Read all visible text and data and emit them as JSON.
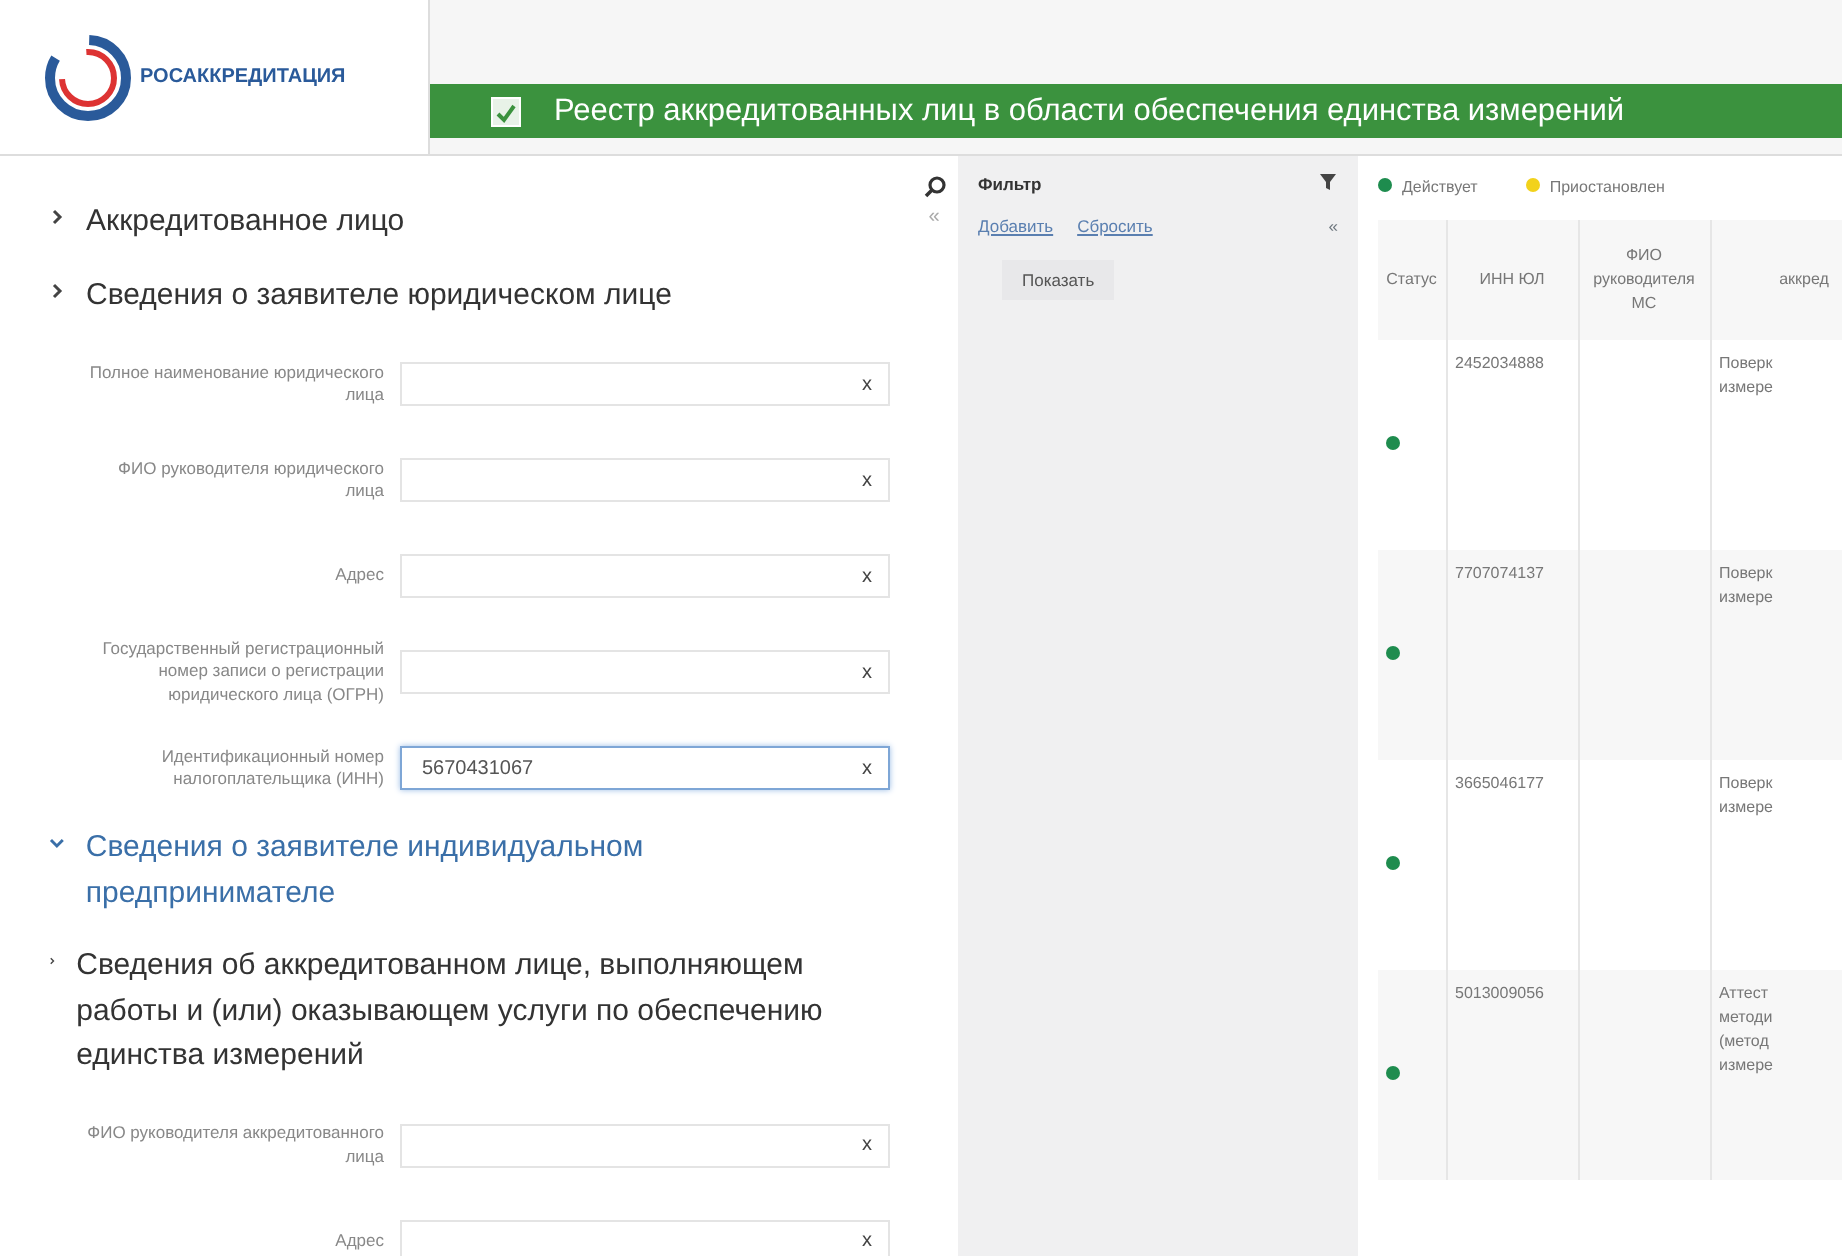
{
  "header": {
    "logo_text": "РОСАККРЕДИТАЦИЯ",
    "title": "Реестр аккредитованных лиц в области обеспечения единства измерений"
  },
  "left_panel": {
    "collapse": "«",
    "sections": [
      {
        "title": "Аккредитованное лицо",
        "expanded": false
      },
      {
        "title": "Сведения о заявителе юридическом лице",
        "expanded": false,
        "fields": [
          {
            "label": "Полное наименование юридического лица",
            "focused": false,
            "clear": "x"
          },
          {
            "label": "ФИО руководителя юридического лица",
            "focused": false,
            "clear": "x"
          },
          {
            "label": "Адрес",
            "focused": false,
            "clear": "x"
          },
          {
            "label": "Государственный регистрационный номер записи о регистрации юридического лица (ОГРН)",
            "focused": false,
            "clear": "x"
          },
          {
            "label": "Идентификационный номер налогоплательщика (ИНН)",
            "value": "5670431067",
            "focused": true,
            "clear": "x"
          }
        ]
      },
      {
        "title": "Сведения о заявителе индивидуальном предпринимателе",
        "expanded": true
      },
      {
        "title": "Сведения об аккредитованном лице, выполняющем работы и (или) оказывающем услуги по обеспечению единства измерений",
        "expanded": false,
        "fields": [
          {
            "label": "ФИО руководителя аккредитованного лица",
            "focused": false,
            "clear": "x"
          },
          {
            "label": "Адрес",
            "focused": false,
            "clear": "x"
          }
        ]
      }
    ]
  },
  "filter": {
    "title": "Фильтр",
    "collapse": "«",
    "links": [
      "Добавить",
      "Сбросить"
    ],
    "button": "Показать"
  },
  "legend": [
    {
      "label": "Действует",
      "color": "#1e8c4e"
    },
    {
      "label": "Приостановлен",
      "color": "#f2d21b"
    }
  ],
  "table": {
    "columns": [
      "Статус",
      "ИНН ЮЛ",
      "ФИО руководителя МС",
      "аккред"
    ],
    "rows": [
      {
        "color": "#1e8c4e",
        "inn": "2452034888",
        "column_4": [
          "Поверк",
          "измере"
        ]
      },
      {
        "color": "#1e8c4e",
        "inn": "7707074137",
        "column_4": [
          "Поверк",
          "измере"
        ]
      },
      {
        "color": "#1e8c4e",
        "inn": "3665046177",
        "column_4": [
          "Поверк",
          "измере"
        ]
      },
      {
        "color": "#1e8c4e",
        "inn": "5013009056",
        "column_4": [
          "Аттест",
          "методи",
          "(метод",
          "измере"
        ]
      }
    ]
  }
}
